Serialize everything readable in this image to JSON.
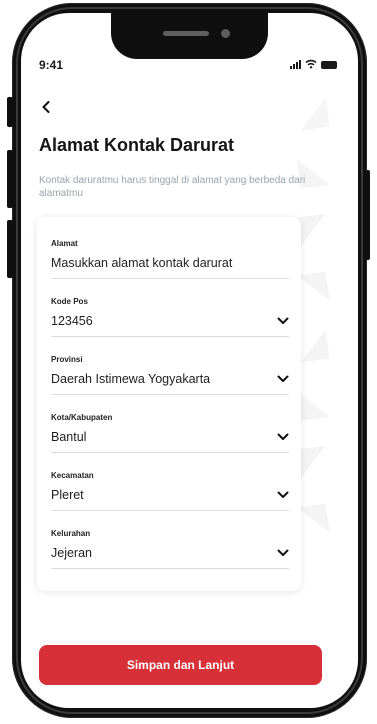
{
  "status_bar": {
    "time": "9:41"
  },
  "header": {
    "back_icon": "chevron-left-icon",
    "title": "Alamat Kontak Darurat",
    "subtitle": "Kontak daruratmu harus tinggal di alamat yang berbeda dari alamatmu"
  },
  "form": {
    "fields": [
      {
        "label": "Alamat",
        "value": "Masukkan alamat kontak darurat",
        "has_dropdown": false
      },
      {
        "label": "Kode Pos",
        "value": "123456",
        "has_dropdown": true
      },
      {
        "label": "Provinsi",
        "value": "Daerah Istimewa Yogyakarta",
        "has_dropdown": true
      },
      {
        "label": "Kota/Kabupaten",
        "value": "Bantul",
        "has_dropdown": true
      },
      {
        "label": "Kecamatan",
        "value": "Pleret",
        "has_dropdown": true
      },
      {
        "label": "Kelurahan",
        "value": "Jejeran",
        "has_dropdown": true
      }
    ]
  },
  "footer": {
    "primary_button": "Simpan dan Lanjut"
  },
  "colors": {
    "accent": "#d83038",
    "subtitle": "#9aa3ad",
    "divider": "#d9dde2"
  }
}
